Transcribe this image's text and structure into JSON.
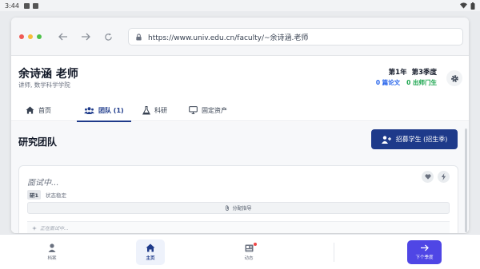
{
  "statusbar": {
    "time": "3:44"
  },
  "browser": {
    "url": "https://www.univ.edu.cn/faculty/~余诗涵.老师"
  },
  "profile": {
    "name": "余诗涵 老师",
    "subtitle": "讲师, 数学科学学院",
    "year": "第1年",
    "quarter": "第3季度",
    "papers": "0 篇论文",
    "trips": "0 出师门生"
  },
  "tabs": [
    {
      "label": "首页",
      "icon": "home-icon"
    },
    {
      "label": "团队 (1)",
      "icon": "users-icon"
    },
    {
      "label": "科研",
      "icon": "flask-icon"
    },
    {
      "label": "固定资产",
      "icon": "monitor-icon"
    }
  ],
  "team": {
    "title": "研究团队",
    "recruit_label": "招募学生 (招生季)",
    "card": {
      "title": "面试中...",
      "badge": "研1",
      "status": "状态稳定",
      "assign_label": "分配指导",
      "interview_status": "正在面试中..."
    }
  },
  "bottom_nav": {
    "items": [
      {
        "label": "档案",
        "icon": "person-icon"
      },
      {
        "label": "主页",
        "icon": "home-icon"
      },
      {
        "label": "动态",
        "icon": "news-icon"
      }
    ],
    "next_label": "下个季度"
  },
  "colors": {
    "primary": "#1e3a8a",
    "accent": "#4f46e5",
    "papers": "#2563eb",
    "trips": "#16a34a"
  }
}
